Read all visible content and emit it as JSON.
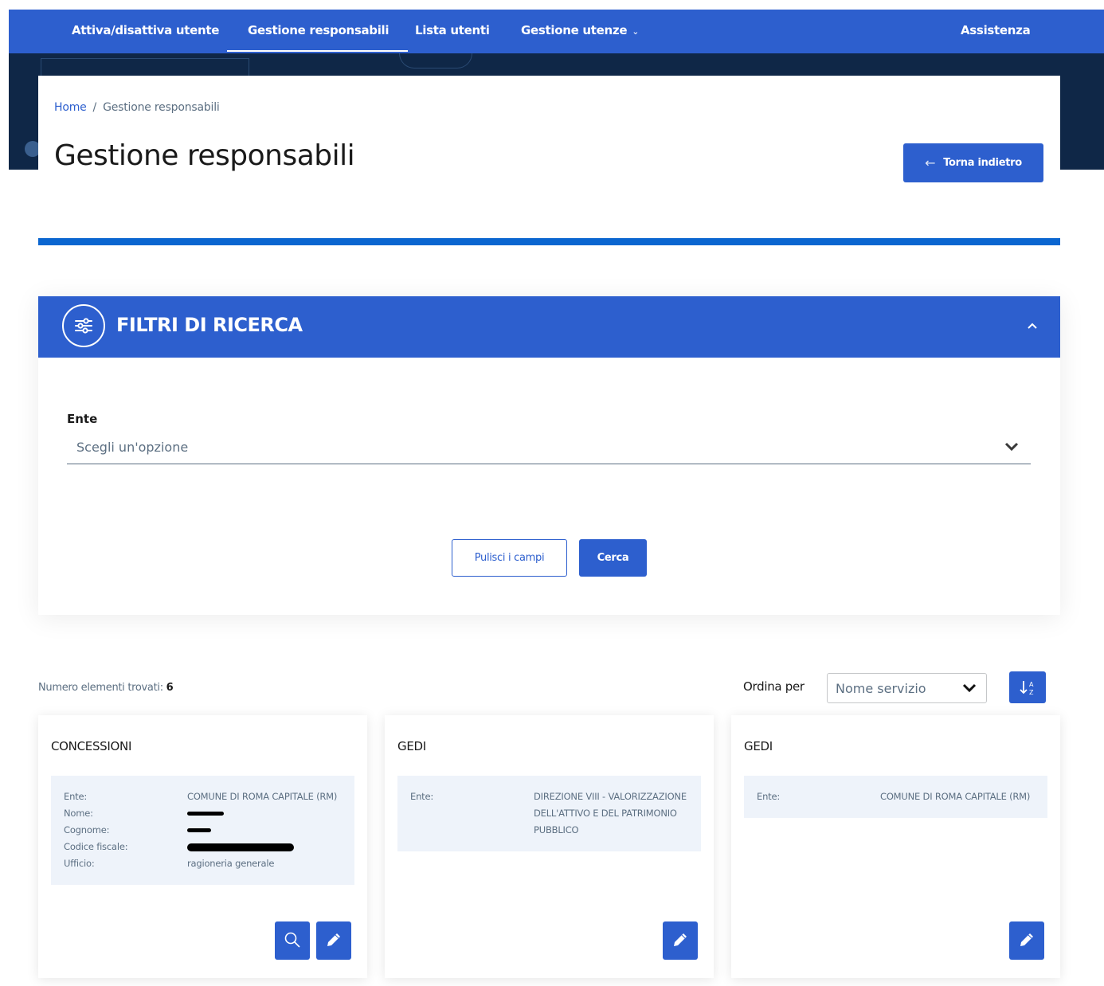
{
  "navbar": {
    "items": [
      {
        "label": "Attiva/disattiva utente"
      },
      {
        "label": "Gestione responsabili",
        "active": true
      },
      {
        "label": "Lista utenti"
      },
      {
        "label": "Gestione utenze",
        "has_dropdown": true
      }
    ],
    "help_label": "Assistenza"
  },
  "breadcrumb": {
    "home": "Home",
    "separator": "/",
    "current": "Gestione responsabili"
  },
  "page_title": "Gestione responsabili",
  "back_button": "Torna indietro",
  "filters": {
    "title": "FILTRI DI RICERCA",
    "ente_label": "Ente",
    "ente_placeholder": "Scegli un'opzione",
    "clear_button": "Pulisci i campi",
    "search_button": "Cerca"
  },
  "results": {
    "count_label": "Numero elementi trovati:",
    "count": "6",
    "sort_label": "Ordina per",
    "sort_value": "Nome servizio"
  },
  "cards": [
    {
      "title": "CONCESSIONI",
      "rows": [
        {
          "key": "Ente:",
          "value": "COMUNE DI ROMA CAPITALE (RM)"
        },
        {
          "key": "Nome:",
          "value": ""
        },
        {
          "key": "Cognome:",
          "value": ""
        },
        {
          "key": "Codice fiscale:",
          "value": ""
        },
        {
          "key": "Ufficio:",
          "value": "ragioneria generale"
        }
      ]
    },
    {
      "title": "GEDI",
      "rows": [
        {
          "key": "Ente:",
          "value": "DIREZIONE VIII - VALORIZZAZIONE DELL'ATTIVO E DEL PATRIMONIO PUBBLICO"
        }
      ]
    },
    {
      "title": "GEDI",
      "rows": [
        {
          "key": "Ente:",
          "value": "COMUNE DI ROMA CAPITALE (RM)"
        }
      ]
    }
  ],
  "colors": {
    "primary": "#2d5fce",
    "hero_dark": "#0f2747",
    "rule": "#0b66d0",
    "info_bg": "#eef3fa"
  }
}
